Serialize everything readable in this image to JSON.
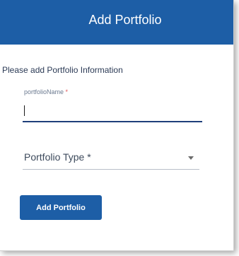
{
  "dialog": {
    "title": "Add Portfolio",
    "instructions": "Please add Portfolio Information",
    "name_field": {
      "label": "portfolioName",
      "required_mark": "*",
      "value": ""
    },
    "type_select": {
      "placeholder": "Portfolio Type *",
      "icon": "chevron-down-icon"
    },
    "submit_label": "Add Portfolio"
  },
  "colors": {
    "primary": "#1d5ea6",
    "input_underline": "#1f3f7a",
    "required": "#e0565a"
  }
}
